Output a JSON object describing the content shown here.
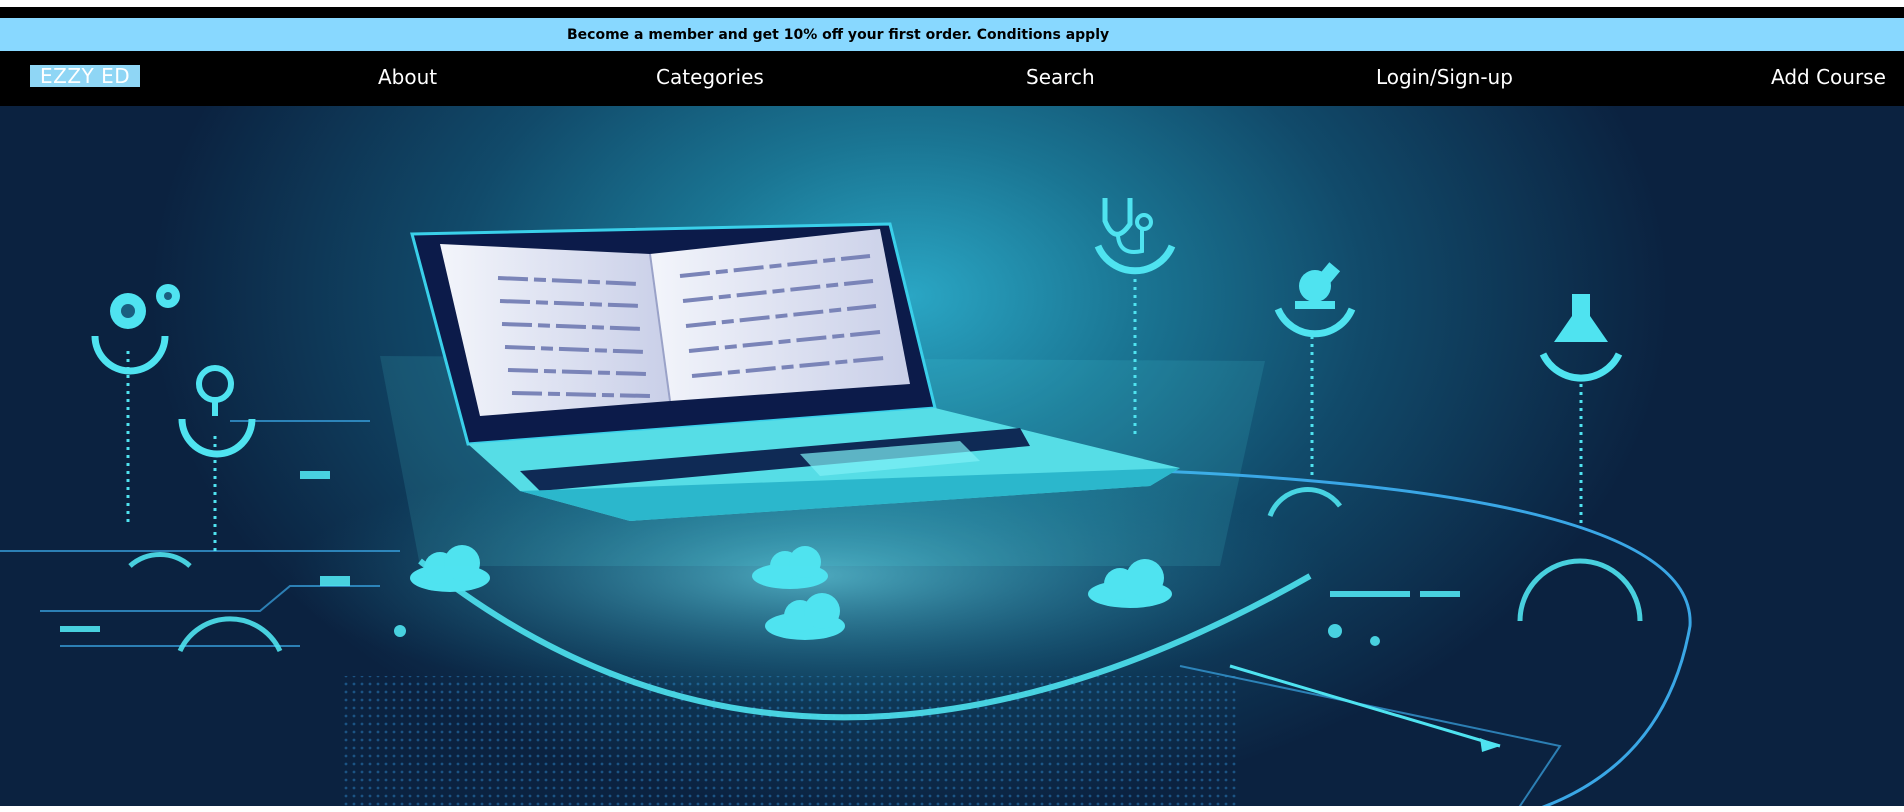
{
  "promo": {
    "text": "Become a member and get 10% off your first order. Conditions apply"
  },
  "nav": {
    "logo": "EZZY ED",
    "items": [
      {
        "label": "About"
      },
      {
        "label": "Categories"
      },
      {
        "label": "Search"
      },
      {
        "label": "Login/Sign-up"
      },
      {
        "label": "Add Course"
      }
    ]
  },
  "hero": {
    "icons": [
      "gears-icon",
      "magnifier-icon",
      "stethoscope-icon",
      "microscope-icon",
      "flask-icon",
      "cloud-icon",
      "laptop-icon",
      "open-book-icon"
    ],
    "colors": {
      "accent": "#4fe3f0",
      "deep": "#0b2240",
      "glow": "#2aa6c4",
      "promo": "#88d8ff"
    }
  }
}
